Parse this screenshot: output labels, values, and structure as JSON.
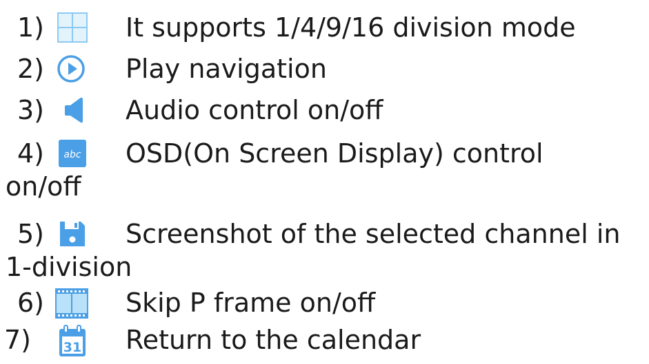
{
  "items": [
    {
      "number": "1)",
      "icon": "grid-division-icon",
      "text": "It supports 1/4/9/16 division mode",
      "continuation": ""
    },
    {
      "number": "2)",
      "icon": "play-circle-icon",
      "text": "Play navigation",
      "continuation": ""
    },
    {
      "number": "3)",
      "icon": "speaker-icon",
      "text": "Audio control on/off",
      "continuation": ""
    },
    {
      "number": "4)",
      "icon": "abc-text-icon",
      "text": "OSD(On Screen Display) control",
      "continuation": "on/off"
    },
    {
      "number": "5)",
      "icon": "floppy-disk-icon",
      "text": "Screenshot of the selected channel in",
      "continuation": "1-division"
    },
    {
      "number": "6)",
      "icon": "film-strip-icon",
      "text": "Skip P frame on/off",
      "continuation": ""
    },
    {
      "number": "7)",
      "icon": "calendar-icon",
      "text": "Return to the calendar",
      "continuation": "",
      "calendar_day": "31"
    }
  ],
  "colors": {
    "icon_blue": "#4a9fe6",
    "icon_light_blue": "#8ccaf3",
    "text": "#1a1a1a"
  }
}
